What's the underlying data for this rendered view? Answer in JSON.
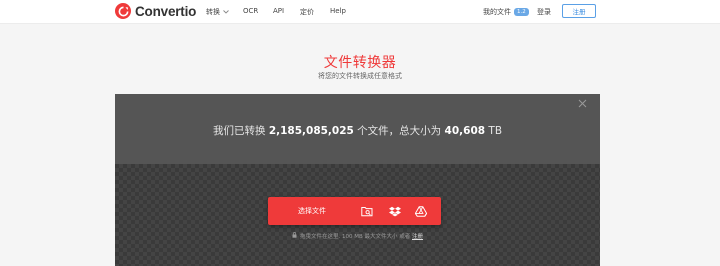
{
  "header": {
    "logo_text": "Convertio",
    "nav": [
      {
        "label": "转换",
        "has_dropdown": true
      },
      {
        "label": "OCR"
      },
      {
        "label": "API"
      },
      {
        "label": "定价"
      },
      {
        "label": "Help"
      }
    ],
    "my_files_label": "我的文件",
    "my_files_count": "1.2",
    "login_label": "登录",
    "signup_label": "注册"
  },
  "hero": {
    "title": "文件转换器",
    "subtitle": "将您的文件转换成任意格式"
  },
  "panel": {
    "stats_prefix": "我们已转换 ",
    "files_count": "2,185,085,025",
    "stats_mid": " 个文件，总大小为 ",
    "total_size": "40,608",
    "stats_unit": " TB",
    "choose_label": "选择文件",
    "sources": [
      "folder-search-icon",
      "dropbox-icon",
      "google-drive-icon"
    ],
    "hint_text": "拖曳文件在这里. 100 MB 最大文件大小 或者 ",
    "hint_link": "注册"
  },
  "colors": {
    "brand_red": "#ef3a3a",
    "panel_dark": "#3d3d3d",
    "accent_blue": "#3b8de0"
  }
}
